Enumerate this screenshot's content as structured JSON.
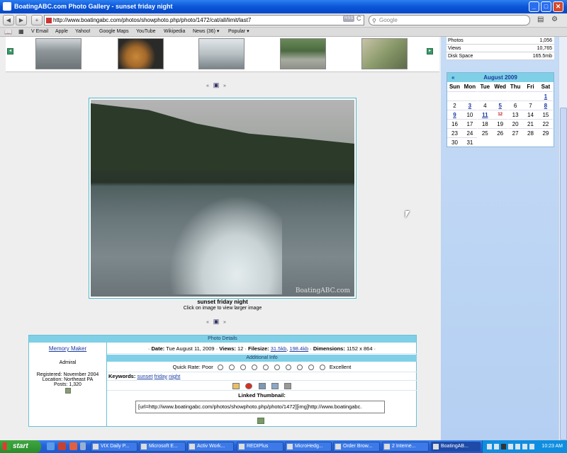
{
  "window": {
    "title": "BoatingABC.com Photo Gallery - sunset friday night",
    "minimize": "_",
    "maximize": "□",
    "close": "✕"
  },
  "nav": {
    "back": "◀",
    "forward": "▶",
    "add": "+",
    "url": "http://www.boatingabc.com/photos/showphoto.php/photo/1472/cat/all/limit/last7",
    "rss": "RSS",
    "reload": "C",
    "search_placeholder": "Google",
    "page_menu": "▤",
    "settings_menu": "⚙"
  },
  "bookmarks": [
    "V Email",
    "Apple",
    "Yahoo!",
    "Google Maps",
    "YouTube",
    "Wikipedia",
    "News (36) ▾",
    "Popular ▾"
  ],
  "gallery": {
    "prev_icons": "«  ▣  »",
    "photo_title": "sunset friday night",
    "photo_sub": "Click on image to view larger image",
    "watermark": "BoatingABC.com"
  },
  "details": {
    "header": "Photo Details",
    "additional_header": "Additional Info",
    "user": {
      "name": "Memory Maker",
      "rank": "Admiral",
      "registered": "Registered: November 2004",
      "location": "Location: Northeast PA",
      "posts": "Posts: 1,320"
    },
    "info_line": {
      "date_label": "Date:",
      "date": "Tue August 11, 2009",
      "views_label": "Views:",
      "views": "12",
      "filesize_label": "Filesize:",
      "filesize_small": "31.5kb",
      "filesize_large": "198.4kb",
      "dimensions_label": "Dimensions:",
      "dimensions": "1152 x 864"
    },
    "quick_rate": {
      "label": "Quick Rate: Poor",
      "end_label": "Excellent",
      "count": 10
    },
    "keywords": {
      "label": "Keywords:",
      "words": [
        "sunset",
        "friday",
        "night"
      ]
    },
    "linked_thumbnail_label": "Linked Thumbnail:",
    "bbcode": "[url=http://www.boatingabc.com/photos/showphoto.php/photo/1472][img]http://www.boatingabc."
  },
  "stats": [
    {
      "label": "Photos",
      "value": "1,056"
    },
    {
      "label": "Views",
      "value": "10,765"
    },
    {
      "label": "Disk Space",
      "value": "165.5mb"
    }
  ],
  "calendar": {
    "month": "August 2009",
    "prev": "«",
    "days_of_week": [
      "Sun",
      "Mon",
      "Tue",
      "Wed",
      "Thu",
      "Fri",
      "Sat"
    ],
    "first_weekday": 6,
    "days_in_month": 31,
    "linked_days": [
      1,
      3,
      5,
      8,
      9,
      11
    ],
    "today": 12
  },
  "taskbar": {
    "start": "start",
    "tasks": [
      {
        "label": "VIX Daily P...",
        "active": false
      },
      {
        "label": "Microsoft E...",
        "active": false
      },
      {
        "label": "Activ Work...",
        "active": false
      },
      {
        "label": "REDIPlus",
        "active": false
      },
      {
        "label": "MicroHedg...",
        "active": false
      },
      {
        "label": "Order Brow...",
        "active": false
      },
      {
        "label": "2 Interne...",
        "active": false
      },
      {
        "label": "BoatingAB...",
        "active": true
      }
    ],
    "clock": "10:23 AM"
  },
  "colors": {
    "accent_blue": "#7fd0e6",
    "link": "#1a3aa0",
    "today": "#c01010"
  }
}
